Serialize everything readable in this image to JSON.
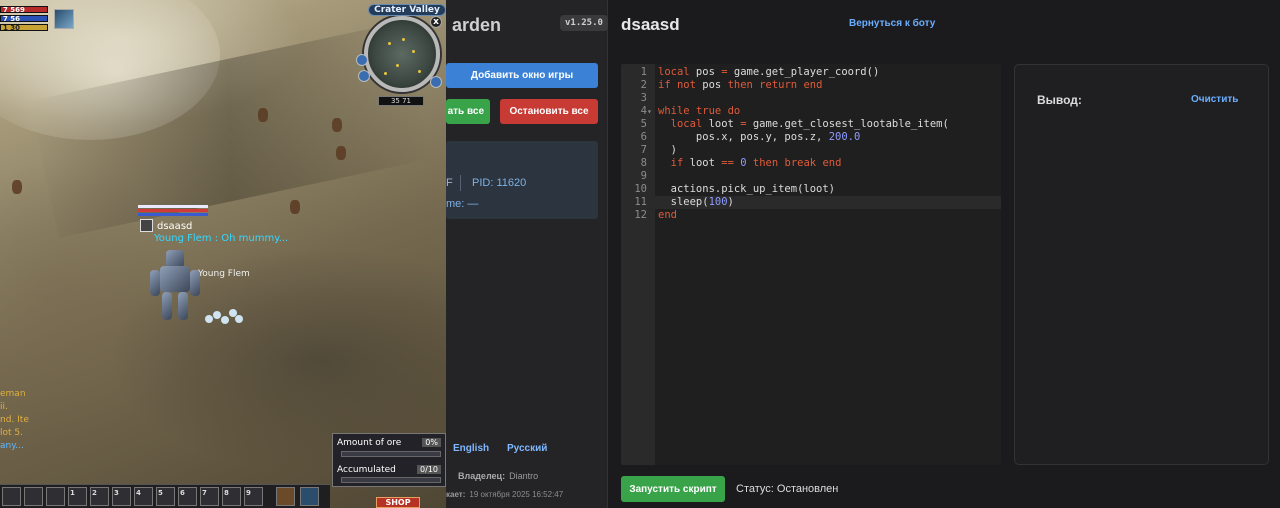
{
  "game": {
    "hp_value": "7 569",
    "mp_value": "7 56",
    "xp_value": "1 30",
    "minimap_title": "Crater Valley",
    "minimap_close": "x",
    "coords": "35  71",
    "char_name": "dsaasd",
    "char_chat": "Young Flem : Oh mummy...",
    "npc_name": "Young Flem",
    "chat_lines": [
      "eman",
      "ii.",
      "nd. Ite",
      "lot 5.",
      "any..."
    ],
    "hotbar_slots": [
      "",
      "",
      "",
      "1",
      "2",
      "3",
      "4",
      "5",
      "6",
      "7",
      "8",
      "9"
    ],
    "quest": {
      "ore_label": "Amount of ore",
      "ore_value": "0%",
      "acc_label": "Accumulated",
      "acc_value": "0/10"
    },
    "shop_label": "SHOP"
  },
  "sidebar": {
    "brand": "arden",
    "version": "v1.25.0",
    "add_window_button": "Добавить окно игры",
    "start_all_button": "ать все",
    "stop_all_button": "Остановить все",
    "info": {
      "f_label": "F",
      "pid": "PID: 11620",
      "me_label": "me: —"
    },
    "lang_english": "English",
    "lang_russian": "Русский",
    "owner_label": "Владелец:",
    "owner_value": "Diantro",
    "updated_label": "кает:",
    "updated_value": "19 октября 2025 16:52:47"
  },
  "main": {
    "title": "dsaasd",
    "back_link": "Вернуться к боту",
    "editor_lines": [
      "local pos = game.get_player_coord()",
      "if not pos then return end",
      "",
      "while true do",
      "  local loot = game.get_closest_lootable_item(",
      "      pos.x, pos.y, pos.z, 200.0",
      "  )",
      "  if loot == 0 then break end",
      "",
      "  actions.pick_up_item(loot)",
      "  sleep(100)",
      "end"
    ],
    "line_numbers": [
      "1",
      "2",
      "3",
      "4",
      "5",
      "6",
      "7",
      "8",
      "9",
      "10",
      "11",
      "12"
    ],
    "active_line": 11,
    "fold_line": 4,
    "output_label": "Вывод:",
    "clear_button": "Очистить",
    "run_button": "Запустить скрипт",
    "status": "Статус: Остановлен"
  },
  "colors": {
    "accent_blue": "#3b82d6",
    "run_green": "#38a349",
    "stop_red": "#c83a34",
    "link_blue": "#6aaeff",
    "keyword": "#e05a3a",
    "number": "#8f9bff"
  }
}
